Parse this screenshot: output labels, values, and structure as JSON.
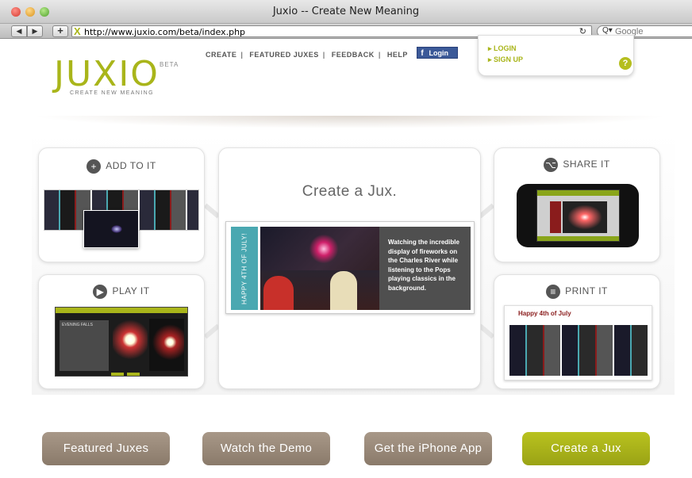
{
  "browser": {
    "window_title": "Juxio -- Create New Meaning",
    "back_label": "◀",
    "forward_label": "▶",
    "add_label": "+",
    "url": "http://www.juxio.com/beta/index.php",
    "search_placeholder": "Google",
    "reload_icon": "reload-icon"
  },
  "header": {
    "logo": "JUXIO",
    "logo_badge": "BETA",
    "tagline": "CREATE NEW MEANING",
    "nav": [
      "CREATE",
      "FEATURED JUXES",
      "FEEDBACK",
      "HELP"
    ],
    "fb_login": "Login",
    "login_box": {
      "login": "LOGIN",
      "signup": "SIGN UP",
      "help": "?"
    }
  },
  "panels": {
    "add": {
      "title": "ADD TO IT",
      "icon": "plus-icon"
    },
    "play": {
      "title": "PLAY IT",
      "icon": "play-icon"
    },
    "share": {
      "title": "SHARE IT",
      "icon": "share-icon"
    },
    "print": {
      "title": "PRINT IT",
      "icon": "document-icon"
    },
    "center": {
      "title": "Create a Jux.",
      "side_text": "HAPPY 4TH OF JULY!",
      "caption": "Watching the incredible display of fireworks on the Charles River while listening to the Pops playing classics in the background."
    },
    "play_screen": {
      "heading": "EVENING FALLS"
    },
    "print_sheet": {
      "title": "Happy 4th of July"
    }
  },
  "buttons": {
    "featured": "Featured Juxes",
    "demo": "Watch the Demo",
    "iphone": "Get the iPhone App",
    "create": "Create a Jux"
  },
  "colors": {
    "brand_green": "#a9b51a",
    "button_brown": "#9a8a7a",
    "teal": "#4aa8b1",
    "facebook_blue": "#3b5998"
  }
}
